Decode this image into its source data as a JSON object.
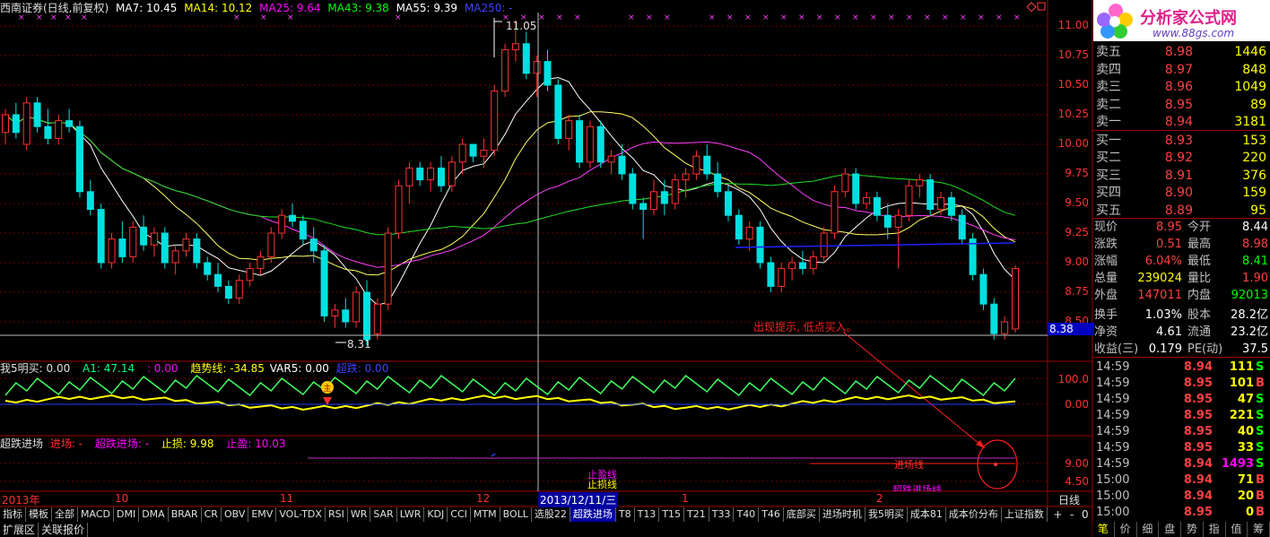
{
  "main_header": {
    "title": "西南证券(日线,前复权)",
    "ma7": "MA7: 10.45",
    "ma14": "MA14: 10.12",
    "ma25": "MA25: 9.64",
    "ma43": "MA43: 9.38",
    "ma55": "MA55: 9.39",
    "ma250": "MA250: -"
  },
  "price_axis": [
    "11.00",
    "10.75",
    "10.50",
    "10.25",
    "10.00",
    "9.75",
    "9.50",
    "9.25",
    "9.00",
    "8.75",
    "8.50"
  ],
  "current_price_tag": "8.38",
  "high_mark": "11.05",
  "low_mark": "8.31",
  "annotation_text": "出现提示, 低点买入。",
  "indicator1": {
    "name": "我5明买",
    "v1": ": 0.00",
    "a1": "A1: 47.14",
    "v2": ": 0.00",
    "trend": "趋势线: -34.85",
    "var5": "VAR5: 0.00",
    "chao": "超跌: 0.00",
    "axis": [
      "100.0",
      "0.00"
    ],
    "marker_glyph": "主"
  },
  "indicator2": {
    "name": "超跌进场",
    "entry": "进场: -",
    "chao_entry": "超跌进场: -",
    "stop": "止损: 9.98",
    "profit": "止盈: 10.03",
    "axis": [
      "9.00",
      "4.50"
    ],
    "lbl_stop_profit": "止盈线",
    "lbl_stop_loss": "止损线",
    "lbl_entry": "进场线",
    "lbl_chao": "超跌进场线"
  },
  "time_axis": {
    "y2013": "2013年",
    "m10": "10",
    "m11": "11",
    "m12": "12",
    "cursor_date": "2013/12/11/三",
    "m1": "1",
    "m2": "2",
    "period": "日线"
  },
  "tabs": [
    "指标",
    "模板",
    "全部",
    "MACD",
    "DMI",
    "DMA",
    "BRAR",
    "CR",
    "OBV",
    "EMV",
    "VOL-TDX",
    "RSI",
    "WR",
    "SAR",
    "LWR",
    "KDJ",
    "CCI",
    "MTM",
    "BOLL",
    "选股22",
    "超跌进场",
    "T8",
    "T13",
    "T15",
    "T21",
    "T33",
    "T40",
    "T46",
    "底部买",
    "进场时机",
    "我5明买",
    "成本81",
    "成本价分布",
    "上证指数"
  ],
  "tab_controls": [
    "+",
    "-",
    "0"
  ],
  "bottom_left": [
    "扩展区",
    "关联报价"
  ],
  "logo": {
    "title": "分析家公式网",
    "url": "www.88gs.com"
  },
  "quotes": [
    {
      "name": "卖五",
      "price": "8.98",
      "vol": "1446"
    },
    {
      "name": "卖四",
      "price": "8.97",
      "vol": "848"
    },
    {
      "name": "卖三",
      "price": "8.96",
      "vol": "1049"
    },
    {
      "name": "卖二",
      "price": "8.95",
      "vol": "89"
    },
    {
      "name": "卖一",
      "price": "8.94",
      "vol": "3181"
    },
    {
      "name": "买一",
      "price": "8.93",
      "vol": "153"
    },
    {
      "name": "买二",
      "price": "8.92",
      "vol": "220"
    },
    {
      "name": "买三",
      "price": "8.91",
      "vol": "376"
    },
    {
      "name": "买四",
      "price": "8.90",
      "vol": "159"
    },
    {
      "name": "买五",
      "price": "8.89",
      "vol": "95"
    }
  ],
  "stats": [
    {
      "l1": "现价",
      "v1": "8.95",
      "c1": "#ff4040",
      "l2": "今开",
      "v2": "8.44",
      "c2": "#ffffff"
    },
    {
      "l1": "涨跌",
      "v1": "0.51",
      "c1": "#ff4040",
      "l2": "最高",
      "v2": "8.98",
      "c2": "#ff4040"
    },
    {
      "l1": "涨幅",
      "v1": "6.04%",
      "c1": "#ff4040",
      "l2": "最低",
      "v2": "8.41",
      "c2": "#00ff00"
    },
    {
      "l1": "总量",
      "v1": "239024",
      "c1": "#ffff00",
      "l2": "量比",
      "v2": "1.90",
      "c2": "#ff4040"
    },
    {
      "l1": "外盘",
      "v1": "147011",
      "c1": "#ff4040",
      "l2": "内盘",
      "v2": "92013",
      "c2": "#00ff00"
    },
    {
      "l1": "换手",
      "v1": "1.03%",
      "c1": "#ffffff",
      "l2": "股本",
      "v2": "28.2亿",
      "c2": "#ffffff"
    },
    {
      "l1": "净资",
      "v1": "4.61",
      "c1": "#ffffff",
      "l2": "流通",
      "v2": "23.2亿",
      "c2": "#ffffff"
    },
    {
      "l1": "收益(三)",
      "v1": "0.179",
      "c1": "#ffffff",
      "l2": "PE(动)",
      "v2": "37.5",
      "c2": "#ffffff"
    }
  ],
  "ticks": [
    {
      "t": "14:59",
      "p": "8.94",
      "v": "111",
      "s": "S",
      "sc": "#00ff00"
    },
    {
      "t": "14:59",
      "p": "8.95",
      "v": "101",
      "s": "B",
      "sc": "#ff4040"
    },
    {
      "t": "14:59",
      "p": "8.95",
      "v": "47",
      "s": "S",
      "sc": "#00ff00"
    },
    {
      "t": "14:59",
      "p": "8.95",
      "v": "221",
      "s": "S",
      "sc": "#00ff00"
    },
    {
      "t": "14:59",
      "p": "8.95",
      "v": "40",
      "s": "S",
      "sc": "#00ff00"
    },
    {
      "t": "14:59",
      "p": "8.95",
      "v": "33",
      "s": "S",
      "sc": "#00ff00"
    },
    {
      "t": "14:59",
      "p": "8.94",
      "v": "1493",
      "s": "S",
      "sc": "#00ff00",
      "vc": "#ff00ff"
    },
    {
      "t": "15:00",
      "p": "8.94",
      "v": "71",
      "s": "B",
      "sc": "#ff4040"
    },
    {
      "t": "15:00",
      "p": "8.94",
      "v": "20",
      "s": "B",
      "sc": "#ff4040"
    },
    {
      "t": "15:00",
      "p": "8.95",
      "v": "0",
      "s": "B",
      "sc": "#ff4040"
    }
  ],
  "bottom_tabs": [
    "笔",
    "价",
    "细",
    "盘",
    "势",
    "指",
    "值",
    "筹"
  ],
  "chart_data": {
    "type": "candlestick",
    "y_range": [
      8.3,
      11.1
    ],
    "candles": [
      [
        10.1,
        10.3,
        10.0,
        10.25
      ],
      [
        10.25,
        10.35,
        10.05,
        10.1
      ],
      [
        10.0,
        10.4,
        9.95,
        10.35
      ],
      [
        10.35,
        10.4,
        10.1,
        10.15
      ],
      [
        10.15,
        10.3,
        10.0,
        10.05
      ],
      [
        10.05,
        10.25,
        10.0,
        10.2
      ],
      [
        10.2,
        10.3,
        10.1,
        10.15
      ],
      [
        10.15,
        10.2,
        9.55,
        9.6
      ],
      [
        9.6,
        9.7,
        9.4,
        9.45
      ],
      [
        9.45,
        9.5,
        8.95,
        9.0
      ],
      [
        9.0,
        9.25,
        8.95,
        9.2
      ],
      [
        9.2,
        9.35,
        9.0,
        9.05
      ],
      [
        9.05,
        9.35,
        9.0,
        9.3
      ],
      [
        9.3,
        9.4,
        9.1,
        9.15
      ],
      [
        9.15,
        9.3,
        9.05,
        9.25
      ],
      [
        9.25,
        9.3,
        8.95,
        9.0
      ],
      [
        9.0,
        9.15,
        8.9,
        9.1
      ],
      [
        9.1,
        9.25,
        9.05,
        9.2
      ],
      [
        9.2,
        9.25,
        8.95,
        9.0
      ],
      [
        9.0,
        9.05,
        8.85,
        8.9
      ],
      [
        8.9,
        9.0,
        8.75,
        8.8
      ],
      [
        8.8,
        8.85,
        8.65,
        8.7
      ],
      [
        8.7,
        8.9,
        8.65,
        8.85
      ],
      [
        8.85,
        9.0,
        8.8,
        8.95
      ],
      [
        8.95,
        9.1,
        8.9,
        9.05
      ],
      [
        9.05,
        9.3,
        9.0,
        9.25
      ],
      [
        9.25,
        9.45,
        9.2,
        9.4
      ],
      [
        9.4,
        9.5,
        9.3,
        9.35
      ],
      [
        9.35,
        9.4,
        9.15,
        9.2
      ],
      [
        9.2,
        9.3,
        9.0,
        9.1
      ],
      [
        9.1,
        9.15,
        8.5,
        8.55
      ],
      [
        8.55,
        8.65,
        8.45,
        8.6
      ],
      [
        8.6,
        8.7,
        8.45,
        8.5
      ],
      [
        8.5,
        8.8,
        8.45,
        8.75
      ],
      [
        8.75,
        8.85,
        8.3,
        8.35
      ],
      [
        8.4,
        8.7,
        8.35,
        8.65
      ],
      [
        8.65,
        9.3,
        8.6,
        9.25
      ],
      [
        9.25,
        9.7,
        9.2,
        9.65
      ],
      [
        9.65,
        9.85,
        9.5,
        9.8
      ],
      [
        9.8,
        9.85,
        9.65,
        9.7
      ],
      [
        9.7,
        9.85,
        9.6,
        9.8
      ],
      [
        9.8,
        9.9,
        9.6,
        9.65
      ],
      [
        9.65,
        9.9,
        9.6,
        9.85
      ],
      [
        9.85,
        10.05,
        9.75,
        10.0
      ],
      [
        10.0,
        10.0,
        9.85,
        9.9
      ],
      [
        9.9,
        10.05,
        9.8,
        9.95
      ],
      [
        9.95,
        10.5,
        9.9,
        10.45
      ],
      [
        10.45,
        10.85,
        10.4,
        10.8
      ],
      [
        10.8,
        11.05,
        10.7,
        10.85
      ],
      [
        10.85,
        10.95,
        10.55,
        10.6
      ],
      [
        10.6,
        10.75,
        10.4,
        10.7
      ],
      [
        10.7,
        10.8,
        10.45,
        10.5
      ],
      [
        10.5,
        10.55,
        10.0,
        10.05
      ],
      [
        10.05,
        10.25,
        9.95,
        10.2
      ],
      [
        10.2,
        10.25,
        9.8,
        9.85
      ],
      [
        9.85,
        10.2,
        9.8,
        10.15
      ],
      [
        10.15,
        10.2,
        9.8,
        9.85
      ],
      [
        9.85,
        9.95,
        9.75,
        9.9
      ],
      [
        9.9,
        10.0,
        9.7,
        9.75
      ],
      [
        9.75,
        9.8,
        9.45,
        9.5
      ],
      [
        9.5,
        9.55,
        9.2,
        9.45
      ],
      [
        9.45,
        9.7,
        9.4,
        9.6
      ],
      [
        9.6,
        9.7,
        9.4,
        9.5
      ],
      [
        9.5,
        9.75,
        9.45,
        9.7
      ],
      [
        9.7,
        9.8,
        9.55,
        9.75
      ],
      [
        9.75,
        9.95,
        9.7,
        9.9
      ],
      [
        9.9,
        10.0,
        9.7,
        9.75
      ],
      [
        9.75,
        9.85,
        9.55,
        9.6
      ],
      [
        9.6,
        9.65,
        9.35,
        9.4
      ],
      [
        9.4,
        9.45,
        9.15,
        9.2
      ],
      [
        9.2,
        9.35,
        9.1,
        9.3
      ],
      [
        9.3,
        9.35,
        8.95,
        9.0
      ],
      [
        9.0,
        9.05,
        8.75,
        8.8
      ],
      [
        8.8,
        9.0,
        8.75,
        8.95
      ],
      [
        8.95,
        9.05,
        8.85,
        9.0
      ],
      [
        9.0,
        9.1,
        8.9,
        8.95
      ],
      [
        8.95,
        9.1,
        8.9,
        9.05
      ],
      [
        9.05,
        9.3,
        9.0,
        9.25
      ],
      [
        9.25,
        9.65,
        9.2,
        9.6
      ],
      [
        9.6,
        9.8,
        9.55,
        9.75
      ],
      [
        9.75,
        9.8,
        9.45,
        9.5
      ],
      [
        9.5,
        9.6,
        9.45,
        9.55
      ],
      [
        9.55,
        9.6,
        9.35,
        9.4
      ],
      [
        9.4,
        9.5,
        9.2,
        9.3
      ],
      [
        9.3,
        9.45,
        8.95,
        9.4
      ],
      [
        9.4,
        9.7,
        9.35,
        9.65
      ],
      [
        9.65,
        9.75,
        9.55,
        9.7
      ],
      [
        9.7,
        9.75,
        9.4,
        9.45
      ],
      [
        9.45,
        9.6,
        9.4,
        9.55
      ],
      [
        9.55,
        9.6,
        9.35,
        9.4
      ],
      [
        9.4,
        9.45,
        9.15,
        9.2
      ],
      [
        9.2,
        9.25,
        8.85,
        8.9
      ],
      [
        8.9,
        8.95,
        8.6,
        8.65
      ],
      [
        8.65,
        8.7,
        8.35,
        8.4
      ],
      [
        8.4,
        8.55,
        8.35,
        8.5
      ],
      [
        8.44,
        8.98,
        8.41,
        8.95
      ]
    ]
  }
}
